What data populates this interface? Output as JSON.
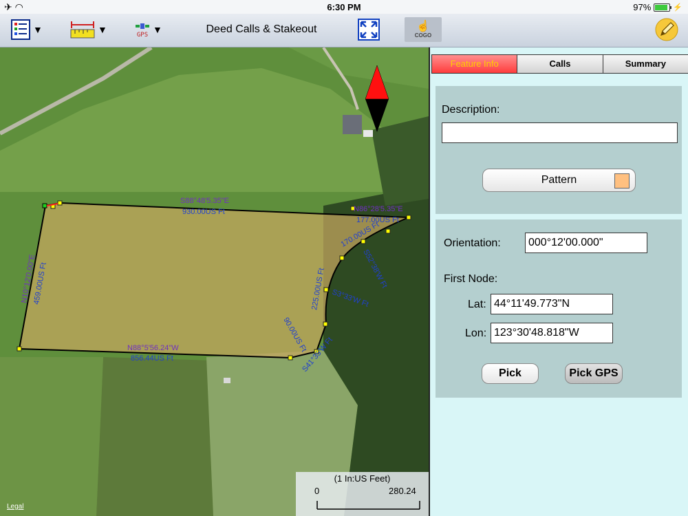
{
  "status": {
    "time": "6:30 PM",
    "battery": "97%"
  },
  "toolbar": {
    "title": "Deed Calls & Stakeout",
    "dropdown_arrow": "▼",
    "gps_label": "GPS",
    "cogo_label": "COGO",
    "icons": [
      "layers-list-icon",
      "measure-ruler-icon",
      "gps-satellite-icon",
      "fullscreen-icon",
      "cogo-pointer-icon",
      "pencil-icon"
    ]
  },
  "map": {
    "legal": "Legal",
    "scale_title": "(1 In:US Feet)",
    "scale_start": "0",
    "scale_end": "280.24",
    "parcel_fill": "#c8a860",
    "calls": {
      "top_bearing": "S88°48'5.35\"E",
      "top_distance": "930.00US Ft",
      "ne_bearing": "N86°28'5.35\"E",
      "ne_distance": "177.00US Ft",
      "curve1": "170.00US Ft",
      "curve1_bearing": "S52°38'W Ft",
      "curve2": "225.00US Ft",
      "curve2_bearing": "S3°33'W Ft",
      "curve3": "90.00US Ft",
      "curve3_bearing": "S41°35'W Ft",
      "bottom_bearing": "N88°5'56.24\"W",
      "bottom_distance": "856.44US Ft",
      "left_bearing": "N10°12'0.00\"E",
      "left_distance": "459.00US Ft"
    }
  },
  "panel": {
    "tabs": [
      {
        "label": "Feature Info",
        "active": true
      },
      {
        "label": "Calls",
        "active": false
      },
      {
        "label": "Summary",
        "active": false
      }
    ],
    "description_label": "Description:",
    "description_value": "",
    "pattern_label": "Pattern",
    "pattern_color": "#ffc080",
    "orientation_label": "Orientation:",
    "orientation_value": "000°12'00.000\"",
    "first_node_label": "First Node:",
    "lat_label": "Lat:",
    "lat_value": "44°11'49.773\"N",
    "lon_label": "Lon:",
    "lon_value": "123°30'48.818\"W",
    "pick_label": "Pick",
    "pick_gps_label": "Pick GPS"
  }
}
